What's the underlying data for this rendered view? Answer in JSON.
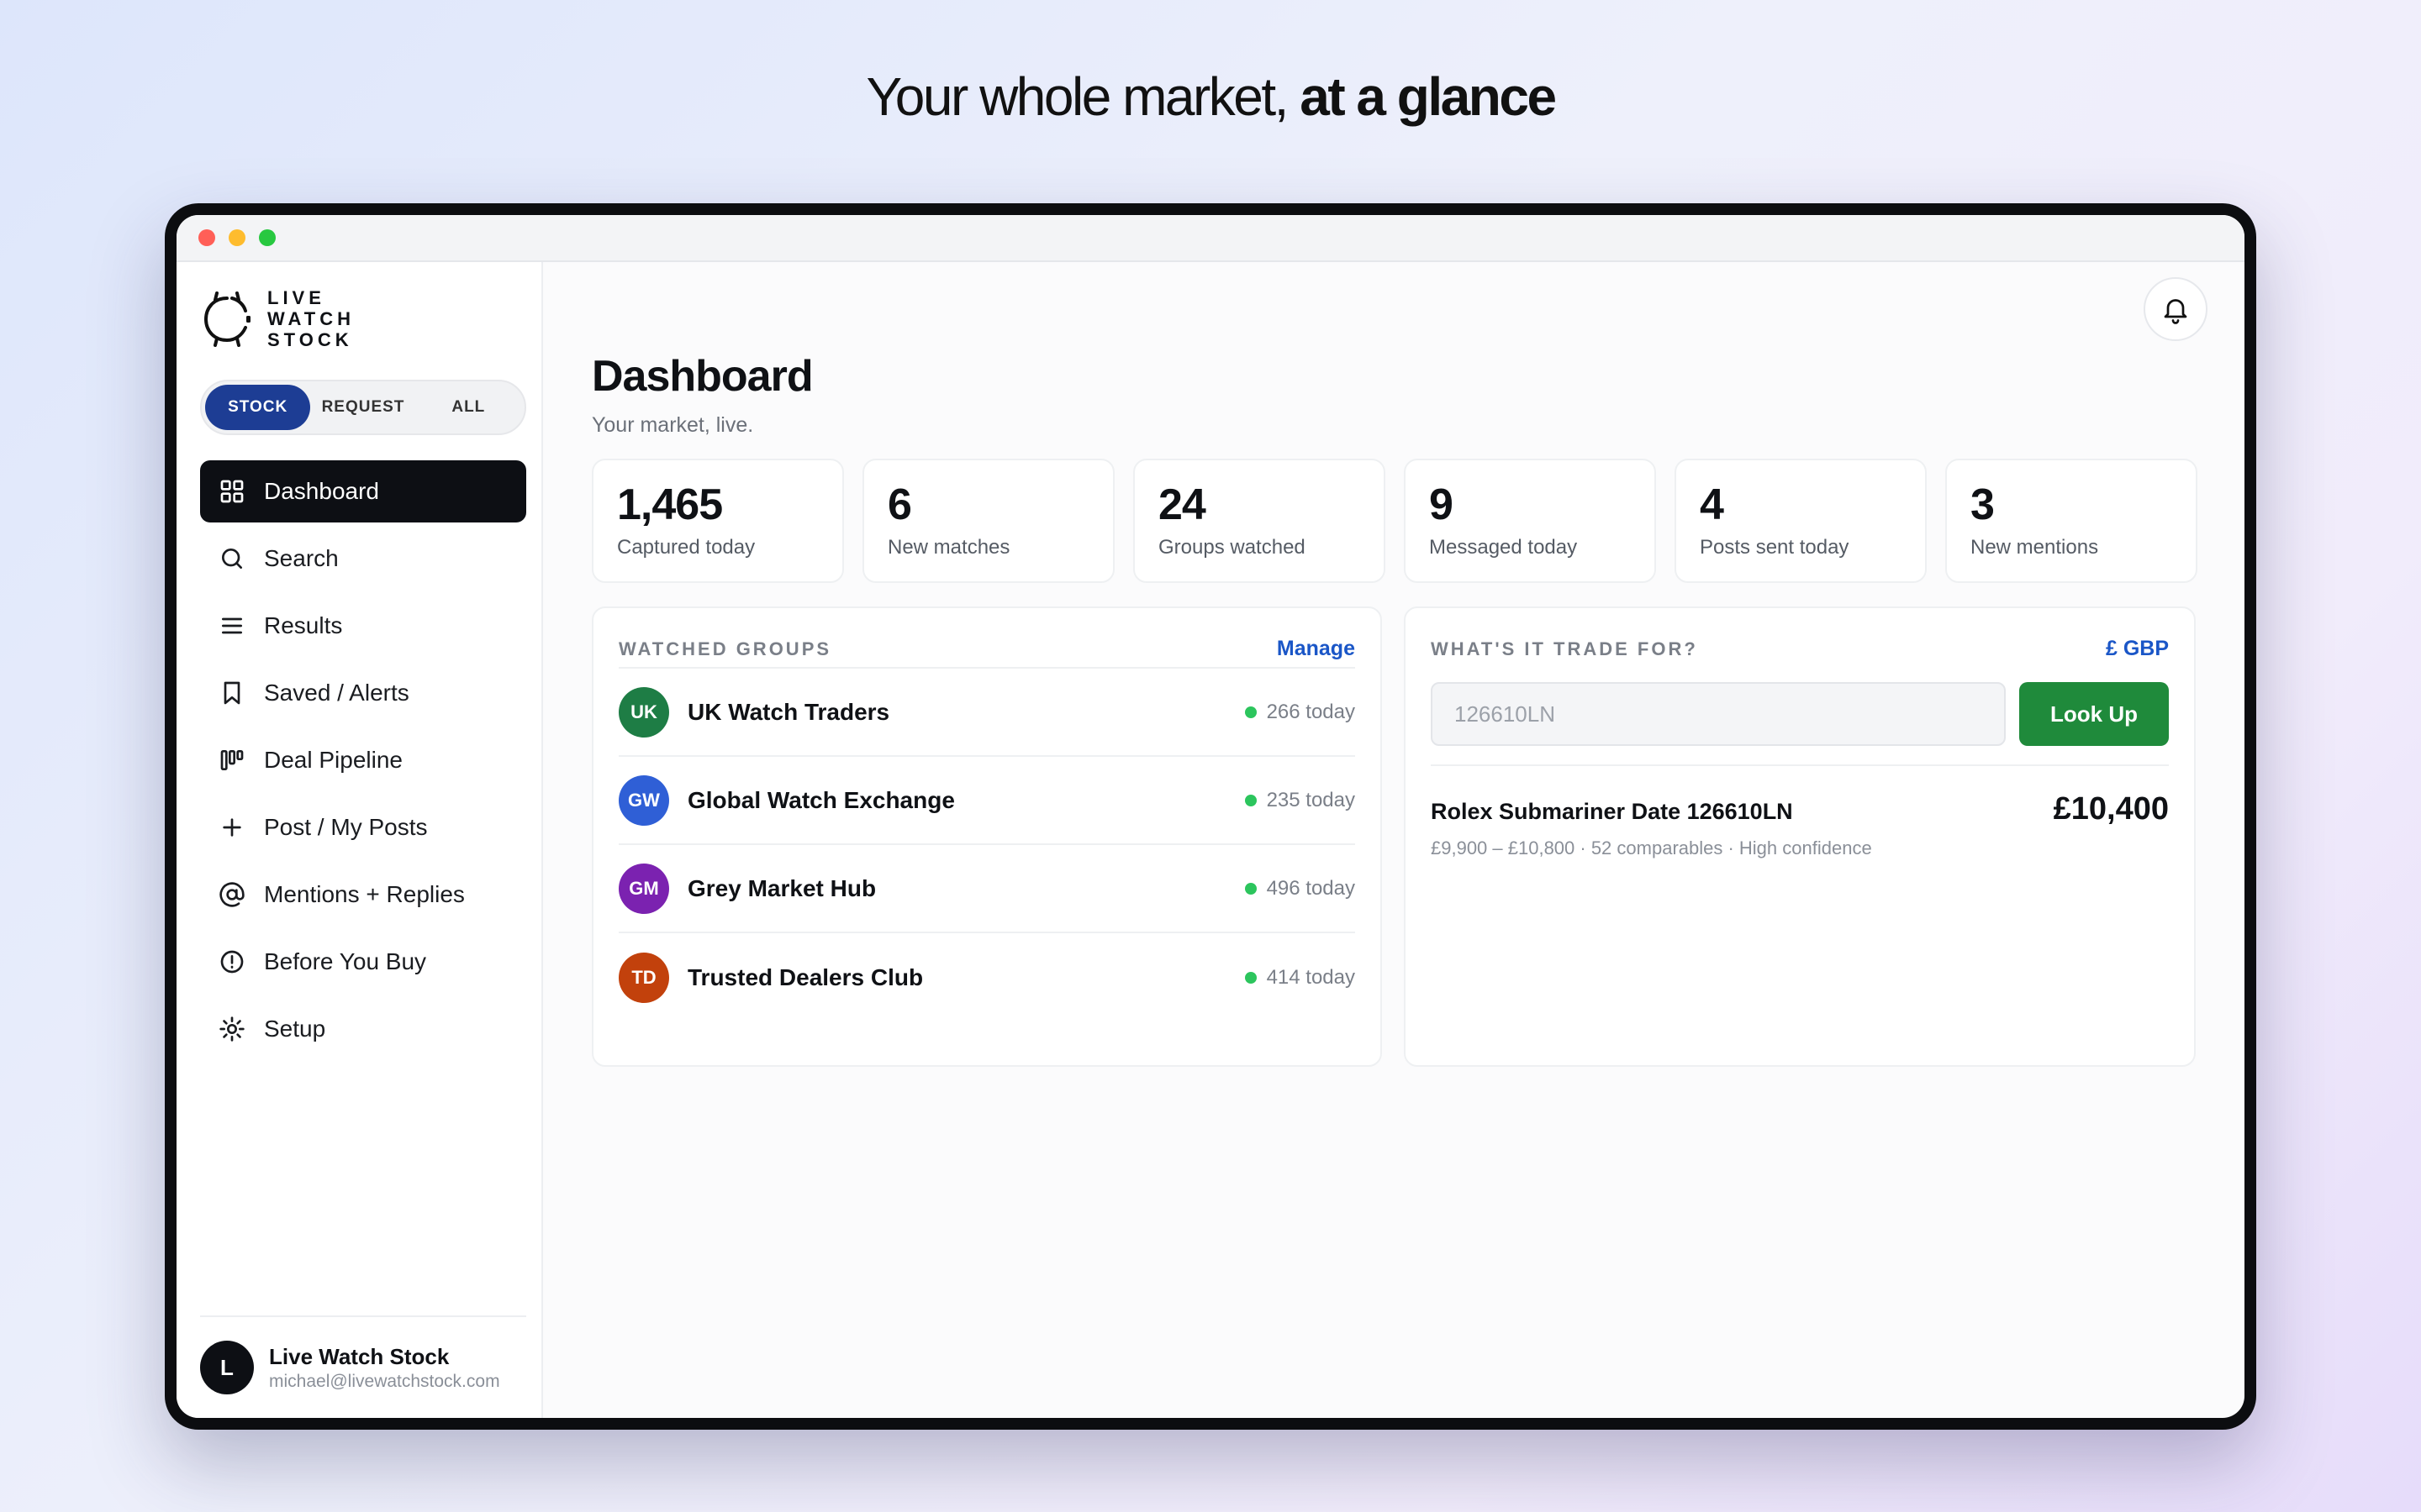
{
  "hero": {
    "text_regular": "Your whole market,",
    "text_bold": "at a glance"
  },
  "brand": {
    "line1": "LIVE",
    "line2": "WATCH",
    "line3": "STOCK"
  },
  "mode_toggle": {
    "options": [
      "STOCK",
      "REQUEST",
      "ALL"
    ],
    "selected": "STOCK"
  },
  "nav": {
    "items": [
      {
        "label": "Dashboard",
        "icon": "grid-icon",
        "active": true
      },
      {
        "label": "Search",
        "icon": "search-icon"
      },
      {
        "label": "Results",
        "icon": "list-icon"
      },
      {
        "label": "Saved / Alerts",
        "icon": "bookmark-icon"
      },
      {
        "label": "Deal Pipeline",
        "icon": "kanban-icon"
      },
      {
        "label": "Post / My Posts",
        "icon": "plus-icon"
      },
      {
        "label": "Mentions + Replies",
        "icon": "at-icon"
      },
      {
        "label": "Before You Buy",
        "icon": "alert-circle-icon"
      },
      {
        "label": "Setup",
        "icon": "gear-icon"
      }
    ]
  },
  "user": {
    "initial": "L",
    "name": "Live Watch Stock",
    "email": "michael@livewatchstock.com"
  },
  "header": {
    "title": "Dashboard",
    "subtitle": "Your market, live.",
    "notification_icon": "bell-icon"
  },
  "stats": [
    {
      "value": "1,465",
      "label": "Captured today"
    },
    {
      "value": "6",
      "label": "New matches"
    },
    {
      "value": "24",
      "label": "Groups watched"
    },
    {
      "value": "9",
      "label": "Messaged today"
    },
    {
      "value": "4",
      "label": "Posts sent today"
    },
    {
      "value": "3",
      "label": "New mentions"
    }
  ],
  "watched_groups": {
    "title": "WATCHED GROUPS",
    "manage_label": "Manage",
    "groups": [
      {
        "initials": "UK",
        "name": "UK Watch Traders",
        "count": "266 today",
        "color": "#1e7d45"
      },
      {
        "initials": "GW",
        "name": "Global Watch Exchange",
        "count": "235 today",
        "color": "#2f5fd6"
      },
      {
        "initials": "GM",
        "name": "Grey Market Hub",
        "count": "496 today",
        "color": "#7b22b0"
      },
      {
        "initials": "TD",
        "name": "Trusted Dealers Club",
        "count": "414 today",
        "color": "#c2410c"
      }
    ]
  },
  "trade": {
    "title": "WHAT'S IT TRADE FOR?",
    "currency_label": "£ GBP",
    "input_placeholder": "126610LN",
    "input_value": "",
    "button_label": "Look Up",
    "result": {
      "name": "Rolex Submariner Date 126610LN",
      "price": "£10,400",
      "meta": "£9,900 – £10,800 · 52 comparables · High confidence"
    }
  },
  "colors": {
    "accent_blue": "#1d3d94",
    "link_blue": "#1a56c7",
    "lookup_green": "#1f8a3b",
    "status_dot": "#2cc55d"
  }
}
